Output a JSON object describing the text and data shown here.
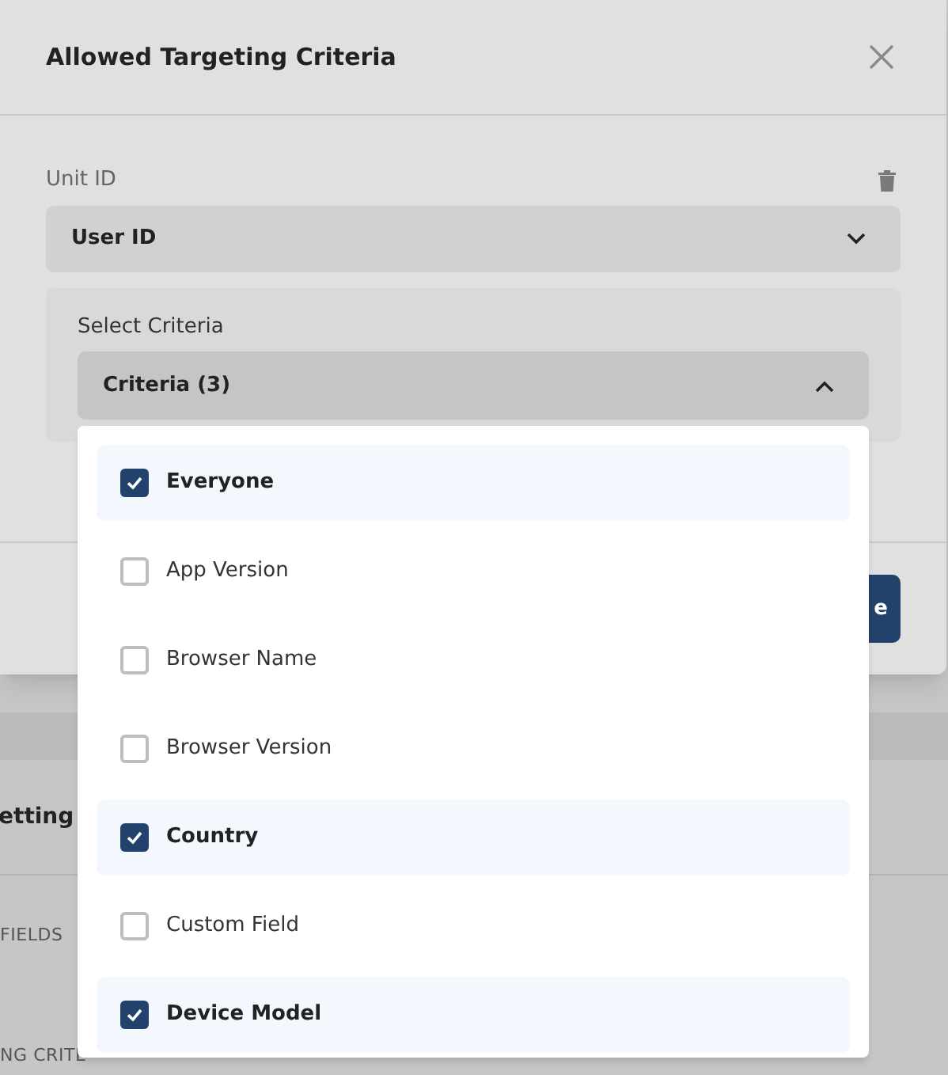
{
  "dialog": {
    "title": "Allowed Targeting Criteria",
    "unit_id": {
      "label": "Unit ID",
      "value": "User ID"
    },
    "criteria": {
      "label": "Select Criteria",
      "value": "Criteria (3)",
      "expanded": true,
      "options": [
        {
          "label": "Everyone",
          "checked": true
        },
        {
          "label": "App Version",
          "checked": false
        },
        {
          "label": "Browser Name",
          "checked": false
        },
        {
          "label": "Browser Version",
          "checked": false
        },
        {
          "label": "Country",
          "checked": true
        },
        {
          "label": "Custom Field",
          "checked": false
        },
        {
          "label": "Device Model",
          "checked": true
        }
      ]
    },
    "footer_button": "e"
  },
  "background": {
    "heading": "etting",
    "items": [
      "FIELDS",
      "NG CRITE"
    ]
  }
}
